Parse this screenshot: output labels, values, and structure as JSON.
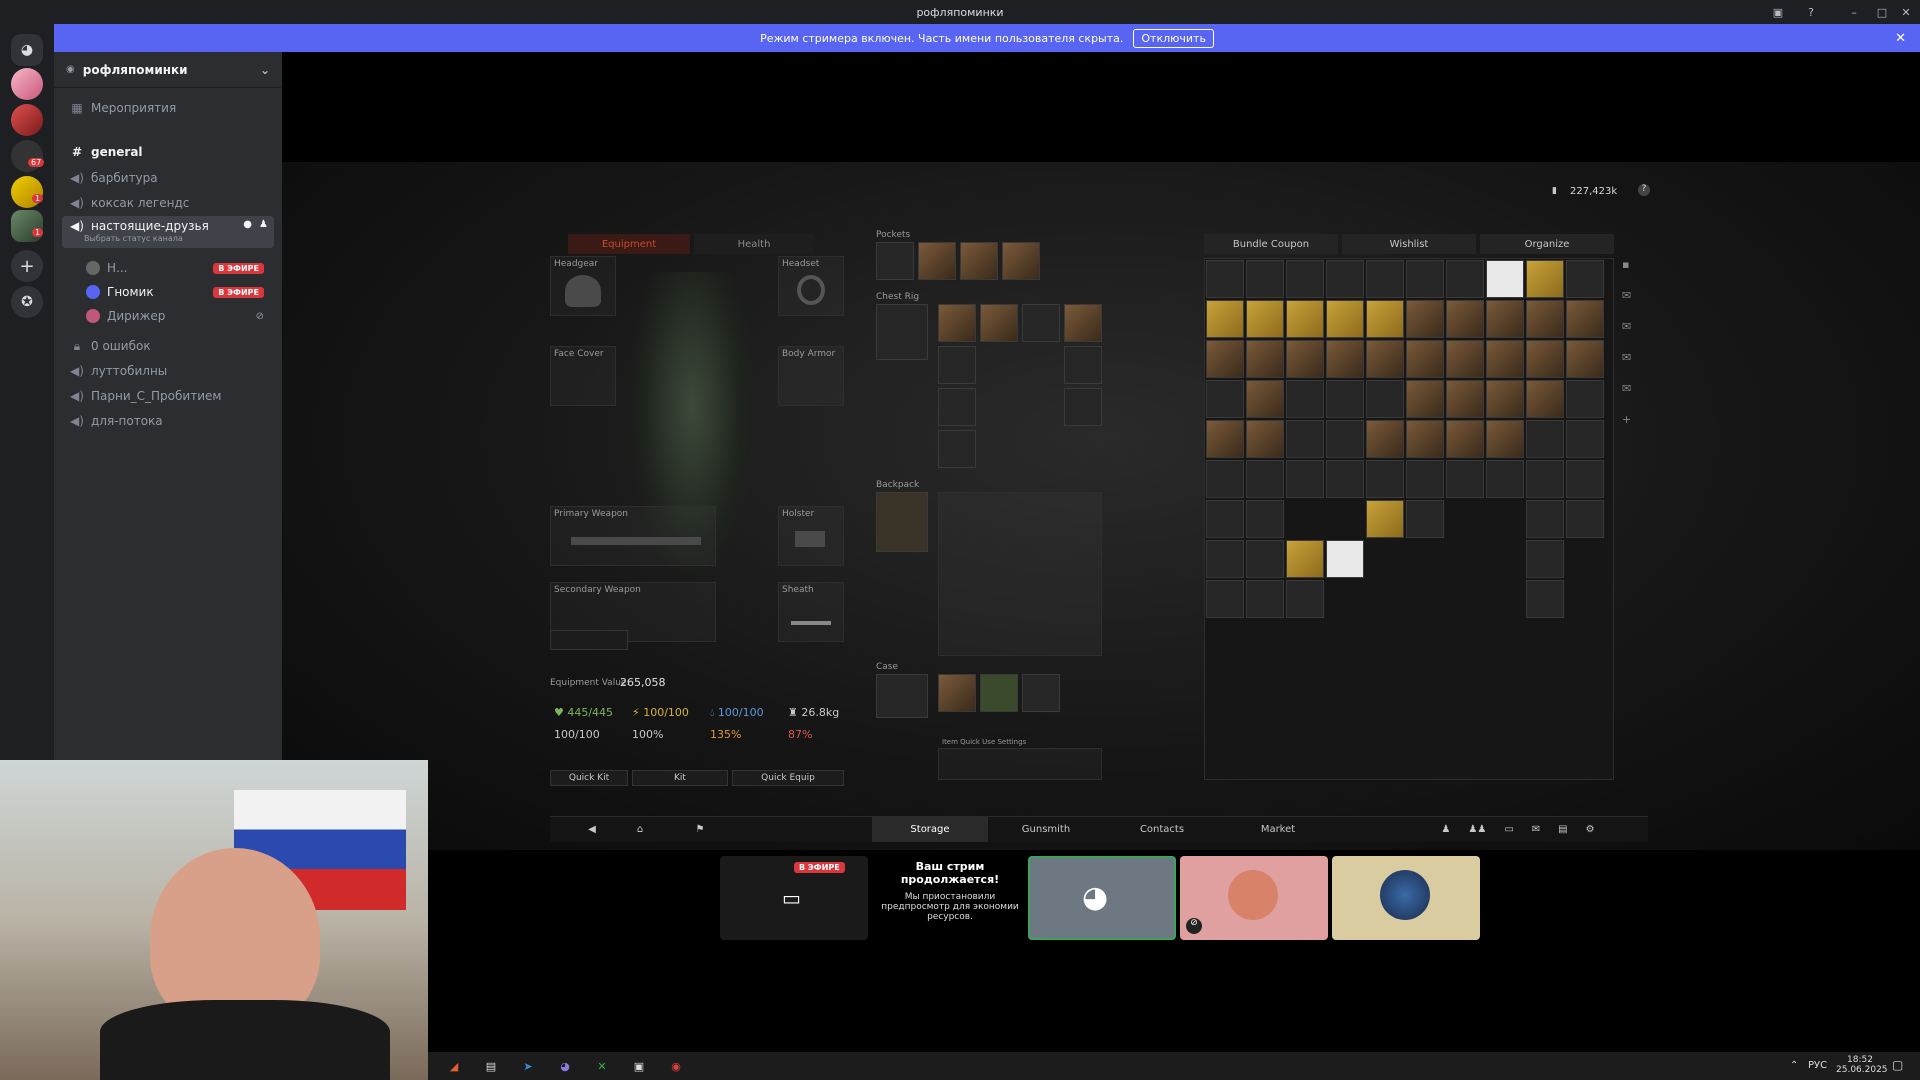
{
  "window": {
    "title": "рофляпоминки"
  },
  "banner": {
    "text": "Режим стримера включен. Часть имени пользователя скрыта.",
    "button": "Отключить"
  },
  "server": {
    "name": "рофляпоминки"
  },
  "channels": {
    "events": "Мероприятия",
    "general": "general",
    "c1": "барбитура",
    "c2": "коксак легендс",
    "c3": "настоящие-друзья",
    "c3_status": "Выбрать статус канала",
    "users": [
      {
        "name": "Н...",
        "badge": "В ЭФИРЕ"
      },
      {
        "name": "Гномик",
        "badge": "В ЭФИРЕ"
      },
      {
        "name": "Дирижер",
        "badge": ""
      }
    ],
    "c4": "0 ошибок",
    "c5": "луттобилны",
    "c6": "Парни_С_Пробитием",
    "c7": "для-потока"
  },
  "rail_badges": {
    "b1": "67",
    "b2": "1",
    "b3": "1"
  },
  "game": {
    "roubles": "227,423k",
    "tabs": {
      "equipment": "Equipment",
      "health": "Health"
    },
    "slots": {
      "headgear": "Headgear",
      "headset": "Headset",
      "face_cover": "Face Cover",
      "body_armor": "Body Armor",
      "primary": "Primary Weapon",
      "secondary": "Secondary Weapon",
      "holster": "Holster",
      "sheath": "Sheath",
      "pockets": "Pockets",
      "chest_rig": "Chest Rig",
      "backpack": "Backpack",
      "case": "Case",
      "quick_use": "Item Quick Use Settings"
    },
    "equipment_value_label": "Equipment Value:",
    "equipment_value": "265,058",
    "stats": {
      "hp": "445/445",
      "energy": "100/100",
      "hydration": "100/100",
      "weight": "26.8kg",
      "s1": "100/100",
      "s2": "100%",
      "s3": "135%",
      "s4": "87%"
    },
    "buttons": {
      "quick_kit": "Quick Kit",
      "kit": "Kit",
      "quick_equip": "Quick Equip"
    },
    "stash_tabs": {
      "bundle": "Bundle Coupon",
      "wishlist": "Wishlist",
      "organize": "Organize"
    },
    "bottom_tabs": {
      "storage": "Storage",
      "gunsmith": "Gunsmith",
      "contacts": "Contacts",
      "market": "Market"
    }
  },
  "stream_tiles": {
    "live": "В ЭФИРЕ",
    "paused_title": "Ваш стрим продолжается!",
    "paused_body": "Мы приостановили предпросмотр для экономии ресурсов."
  },
  "taskbar": {
    "lang": "РУС",
    "time": "18:52",
    "date": "25.06.2025"
  }
}
